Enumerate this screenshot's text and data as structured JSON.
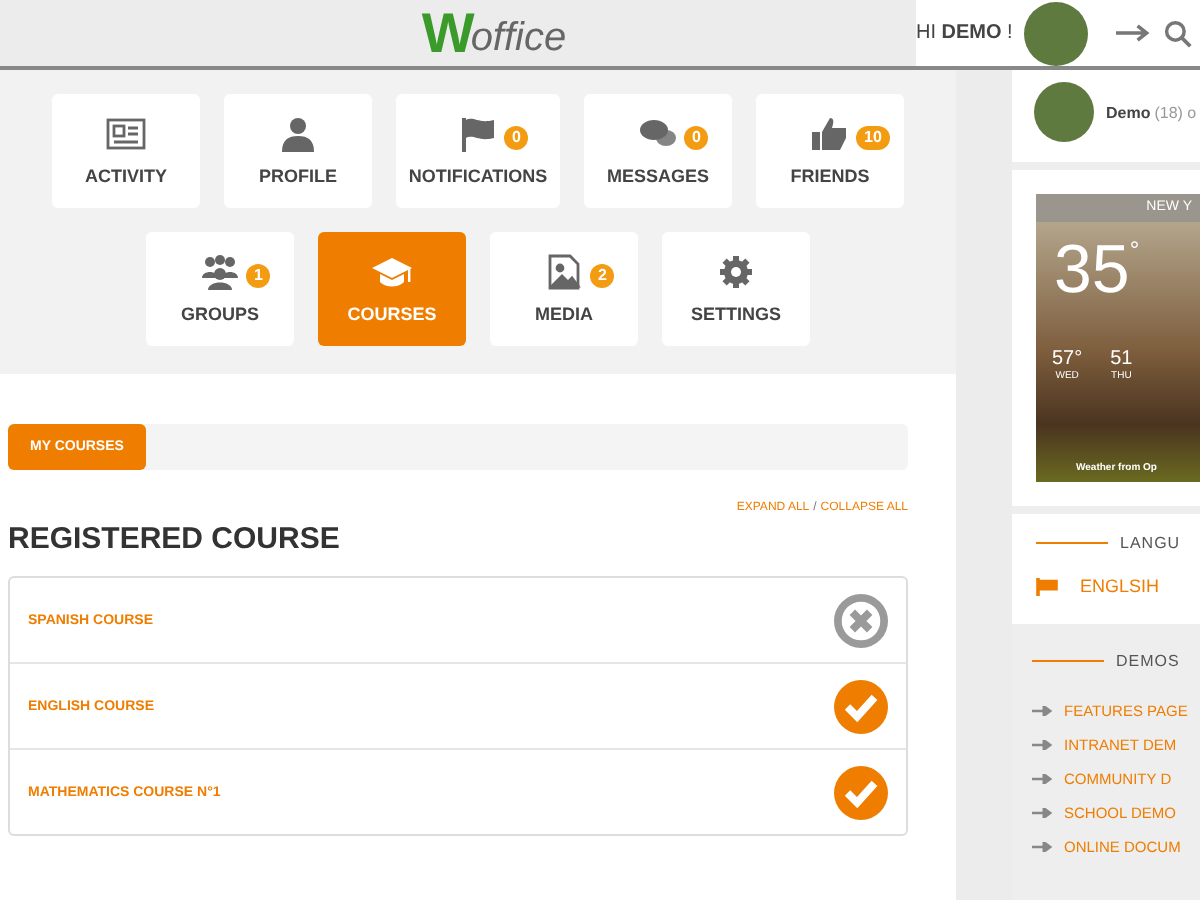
{
  "header": {
    "logo_letter": "W",
    "logo_text": "office",
    "greeting": "HI **DEMO** !"
  },
  "nav": [
    {
      "label": "ACTIVITY",
      "selected": false
    },
    {
      "label": "PROFILE",
      "selected": false
    },
    {
      "label": "NOTIFICATIONS",
      "badge": "0",
      "selected": false
    },
    {
      "label": "MESSAGES",
      "badge": "0",
      "selected": false
    },
    {
      "label": "FRIENDS",
      "badge": "10",
      "selected": false
    },
    {
      "label": "GROUPS",
      "badge": "1",
      "selected": false
    },
    {
      "label": "COURSES",
      "selected": true
    },
    {
      "label": "MEDIA",
      "badge": "2",
      "selected": false
    },
    {
      "label": "SETTINGS",
      "selected": false
    }
  ],
  "courses_tabs": [
    {
      "label": "MY COURSES",
      "selected": true
    }
  ],
  "expand_all": "EXPAND ALL",
  "separator": "/",
  "collapse_all": "COLLAPSE ALL",
  "heading": "REGISTERED COURSE",
  "courses": [
    {
      "title": "SPANISH COURSE",
      "completed": false
    },
    {
      "title": "ENGLISH COURSE",
      "completed": true
    },
    {
      "title": "MATHEMATICS COURSE N°1",
      "completed": true
    }
  ],
  "sidebar": {
    "profile": {
      "name": "Demo",
      "meta": "(18) o"
    },
    "weather": {
      "city": "NEW Y",
      "temp": "35",
      "unit": "°",
      "days": [
        {
          "temp": "57°",
          "day": "WED"
        },
        {
          "temp": "51",
          "day": "THU"
        }
      ],
      "credit": "Weather from Op"
    },
    "language": {
      "title": "LANGU",
      "items": [
        "ENGLSIH"
      ]
    },
    "demos": {
      "title": "DEMOS",
      "links": [
        "FEATURES PAGE",
        "INTRANET DEM",
        "COMMUNITY D",
        "SCHOOL DEMO",
        "ONLINE DOCUM"
      ]
    }
  }
}
